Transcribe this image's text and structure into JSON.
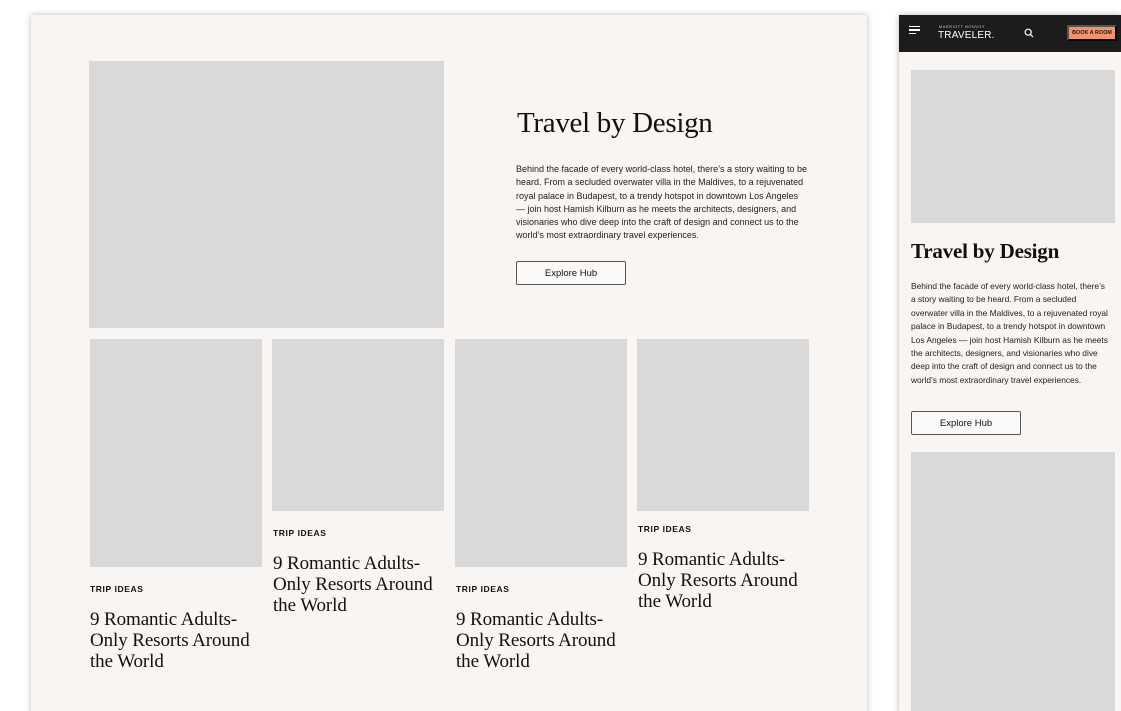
{
  "desktop": {
    "hero": {
      "title": "Travel by Design",
      "body": "Behind the facade of every world-class hotel, there’s a story waiting to be heard. From a secluded overwater villa in the Maldives, to a rejuvenated royal palace in Budapest, to a trendy hotspot in downtown Los Angeles — join host Hamish Kilburn as he meets the architects, designers, and visionaries who dive deep into the craft of design and connect us to the world’s most extraordinary travel experiences.",
      "button_label": "Explore Hub"
    },
    "cards": [
      {
        "eyebrow": "TRIP IDEAS",
        "title": "9 Romantic Adults-Only Resorts Around the World"
      },
      {
        "eyebrow": "TRIP IDEAS",
        "title": "9 Romantic Adults-Only Resorts Around the World"
      },
      {
        "eyebrow": "TRIP IDEAS",
        "title": "9 Romantic Adults-Only Resorts Around the World"
      },
      {
        "eyebrow": "TRIP IDEAS",
        "title": "9 Romantic Adults-Only Resorts Around the World"
      }
    ]
  },
  "mobile": {
    "nav": {
      "logo_small": "MARRIOTT BONVOY",
      "logo": "TRAVELER.",
      "book_label": "BOOK A ROOM",
      "menu_icon": "menu-icon",
      "search_icon": "search-icon"
    },
    "hero": {
      "title": "Travel by Design",
      "body": "Behind the facade of every world-class hotel, there’s a story waiting to be heard. From a secluded overwater villa in the Maldives, to a rejuvenated royal palace in Budapest, to a trendy hotspot in downtown Los Angeles — join host Hamish Kilburn as he meets the architects, designers, and visionaries who dive deep into the craft of design and connect us to the world’s most extraordinary travel experiences.",
      "button_label": "Explore Hub"
    }
  },
  "colors": {
    "background": "#f8f5f2",
    "placeholder": "#d9d9d9",
    "nav": "#1c1c1c",
    "accent": "#f1926a"
  }
}
